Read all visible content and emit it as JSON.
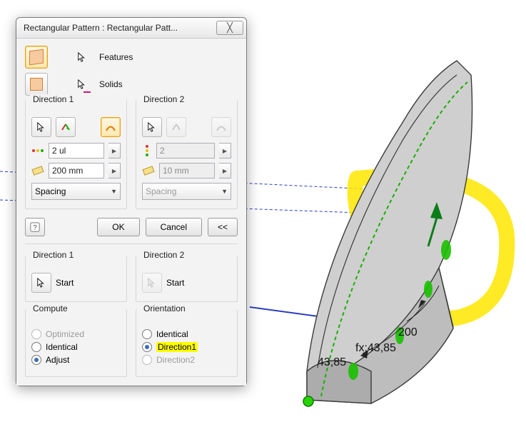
{
  "dialog": {
    "title": "Rectangular Pattern : Rectangular Patt...",
    "features_label": "Features",
    "solids_label": "Solids",
    "ok": "OK",
    "cancel": "Cancel",
    "expand": "<<"
  },
  "dir1": {
    "title": "Direction 1",
    "count": "2 ul",
    "distance": "200 mm",
    "mode": "Spacing"
  },
  "dir2": {
    "title": "Direction 2",
    "count": "2",
    "distance": "10 mm",
    "mode": "Spacing"
  },
  "lower_dir1": {
    "title": "Direction 1",
    "start": "Start"
  },
  "lower_dir2": {
    "title": "Direction 2",
    "start": "Start"
  },
  "compute": {
    "title": "Compute",
    "optimized": "Optimized",
    "identical": "Identical",
    "adjust": "Adjust"
  },
  "orientation": {
    "title": "Orientation",
    "identical": "Identical",
    "direction1": "Direction1",
    "direction2": "Direction2"
  },
  "viewport": {
    "dim_200": "200",
    "dim_fx": "fx:43,85",
    "dim_4385": "43,85"
  }
}
